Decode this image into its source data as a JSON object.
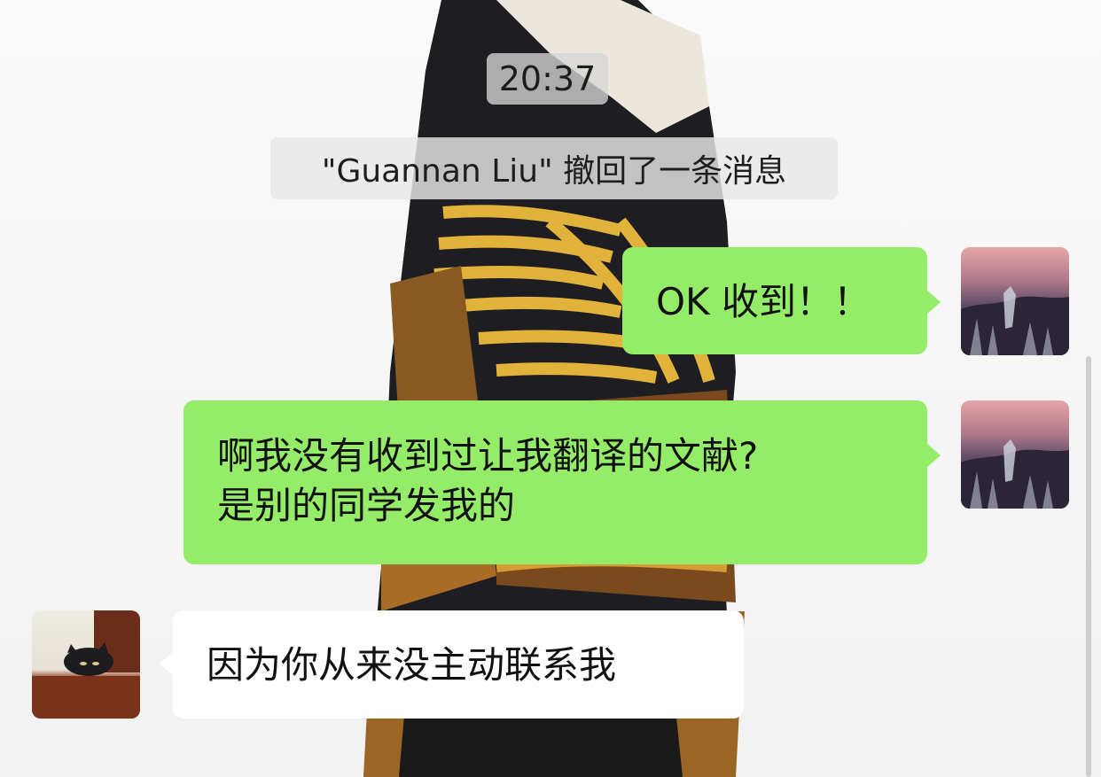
{
  "timestamp": "20:37",
  "system_notice": "\"Guannan Liu\" 撤回了一条消息",
  "messages": [
    {
      "side": "sent",
      "text": "OK 收到！！"
    },
    {
      "side": "sent",
      "lines": [
        "啊我没有收到过让我翻译的文献?",
        "是别的同学发我的"
      ]
    },
    {
      "side": "received",
      "text": "因为你从来没主动联系我"
    }
  ],
  "colors": {
    "sent_bubble": "#95ec69",
    "received_bubble": "#ffffff"
  },
  "icons": {
    "my_avatar": "avatar-sunset-photo",
    "their_avatar": "avatar-cat-photo"
  }
}
